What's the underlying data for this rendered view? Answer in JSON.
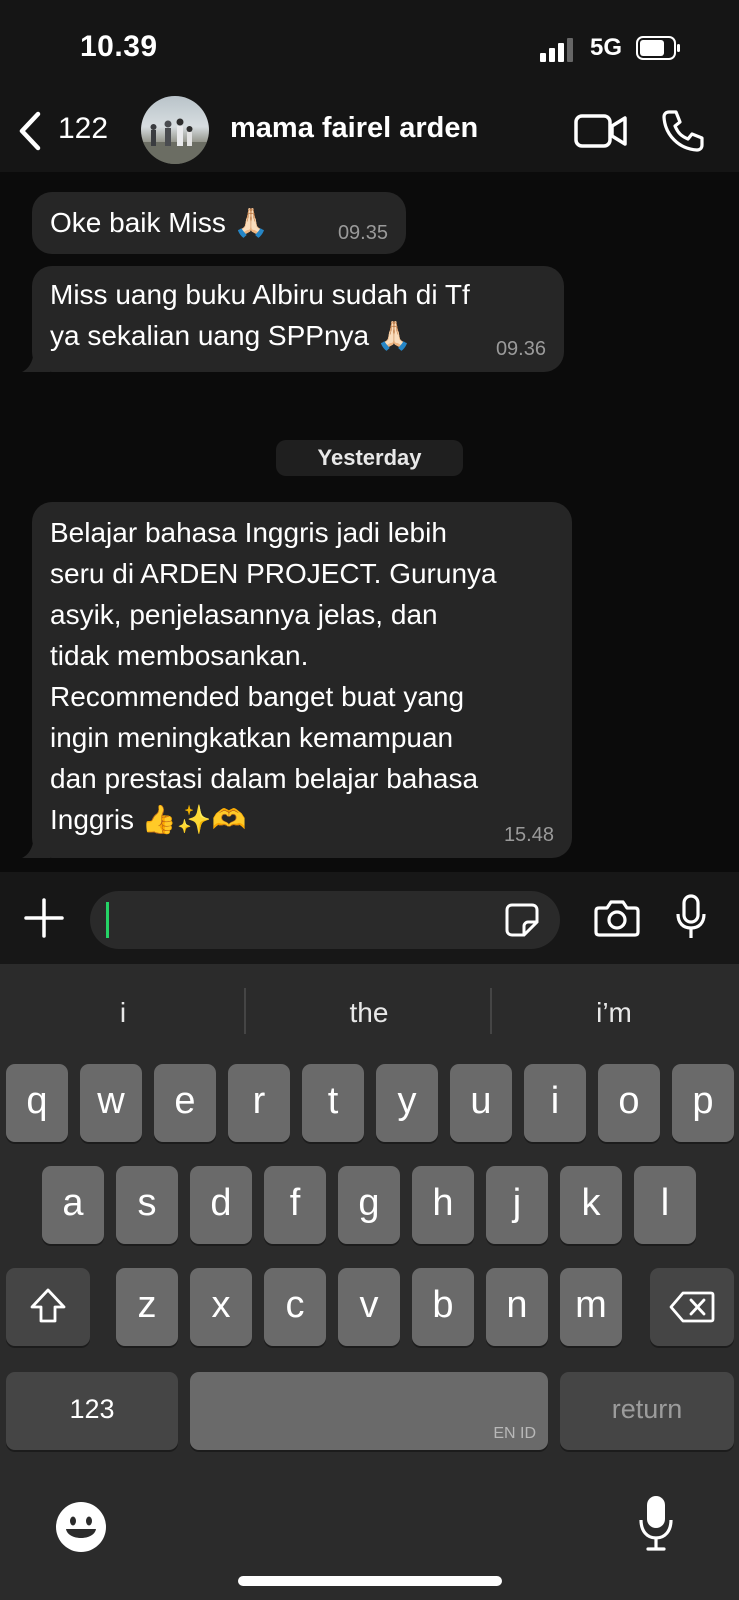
{
  "status_bar": {
    "time": "10.39",
    "network": "5G"
  },
  "header": {
    "back_count": "122",
    "contact_name": "mama fairel arden"
  },
  "messages": [
    {
      "text": "Oke baik Miss 🙏🏻",
      "time": "09.35"
    },
    {
      "text": "Miss uang buku Albiru sudah di Tf\nya sekalian uang SPPnya 🙏🏻",
      "time": "09.36"
    },
    {
      "text": "Belajar bahasa Inggris jadi lebih\nseru di ARDEN PROJECT. Gurunya\nasyik, penjelasannya jelas, dan\ntidak membosankan.\nRecommended banget buat yang\ningin meningkatkan kemampuan\ndan prestasi dalam belajar bahasa\nInggris 👍✨🫶",
      "time": "15.48"
    }
  ],
  "date_separator": "Yesterday",
  "composer": {
    "input_value": ""
  },
  "keyboard": {
    "suggestions": [
      "i",
      "the",
      "i’m"
    ],
    "row1": [
      "q",
      "w",
      "e",
      "r",
      "t",
      "y",
      "u",
      "i",
      "o",
      "p"
    ],
    "row2": [
      "a",
      "s",
      "d",
      "f",
      "g",
      "h",
      "j",
      "k",
      "l"
    ],
    "row3": [
      "z",
      "x",
      "c",
      "v",
      "b",
      "n",
      "m"
    ],
    "numbers_key": "123",
    "space_language": "EN ID",
    "return_key": "return"
  }
}
